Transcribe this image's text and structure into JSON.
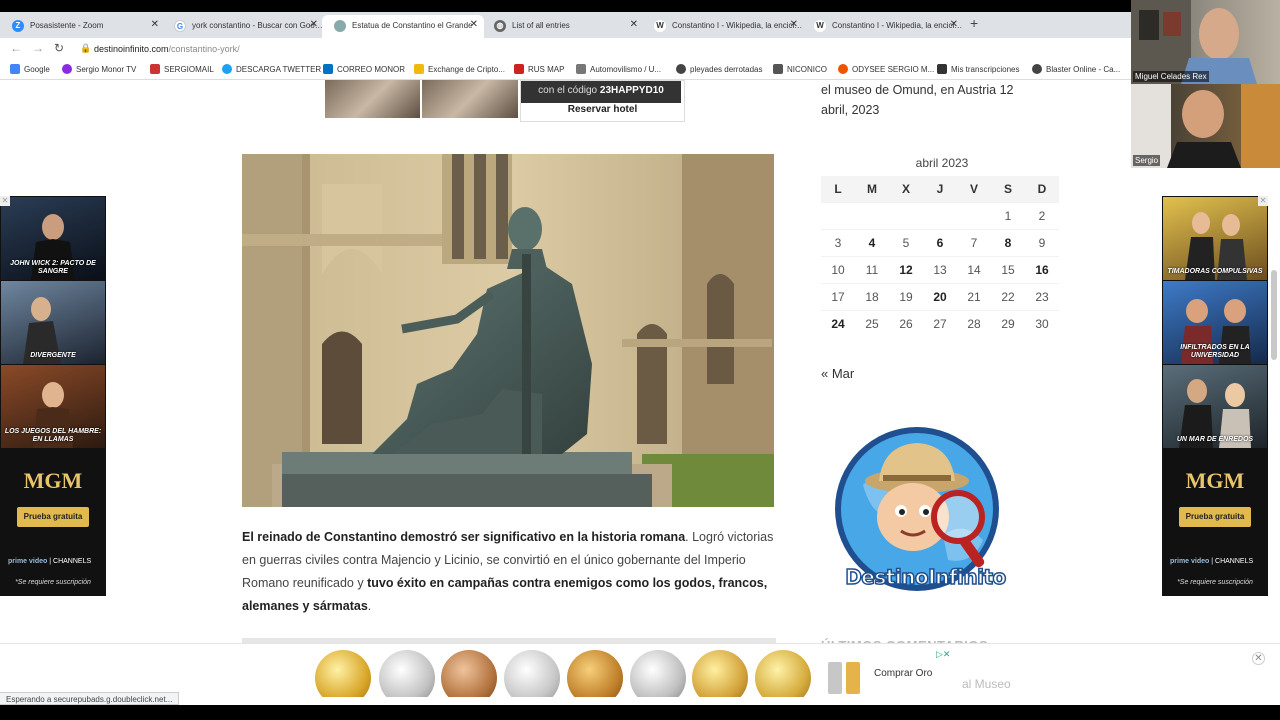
{
  "browser": {
    "tabs": [
      {
        "label": "Posasistente - Zoom",
        "icon": "zoom-icon",
        "color": "#2d8cff",
        "active": false
      },
      {
        "label": "york constantino - Buscar con Google",
        "icon": "google-icon",
        "color": "#4285f4",
        "active": false
      },
      {
        "label": "Estatua de Constantino el Grande",
        "icon": "site-icon",
        "color": "#8aa",
        "active": true
      },
      {
        "label": "List of all entries",
        "icon": "globe-icon",
        "color": "#666",
        "active": false
      },
      {
        "label": "Constantino I - Wikipedia, la enciclopedia",
        "icon": "wikipedia-icon",
        "color": "#333",
        "active": false
      },
      {
        "label": "Constantino I - Wikipedia, la enciclopedia",
        "icon": "wikipedia-icon",
        "color": "#333",
        "active": false
      }
    ],
    "new_tab": "+",
    "url_host": "destinoinfinito.com",
    "url_path": "/constantino-york/",
    "bookmarks": [
      {
        "label": "Google",
        "color": "#4285f4"
      },
      {
        "label": "Sergio Monor TV",
        "color": "#8a2be2"
      },
      {
        "label": "SERGIOMAIL",
        "color": "#c33"
      },
      {
        "label": "DESCARGA TWETTER",
        "color": "#1da1f2"
      },
      {
        "label": "CORREO MONOR",
        "color": "#0072c6"
      },
      {
        "label": "Exchange de Cripto...",
        "color": "#f0b90b"
      },
      {
        "label": "RUS MAP",
        "color": "#c22"
      },
      {
        "label": "Automovilismo / U...",
        "color": "#777"
      },
      {
        "label": "pleyades derrotadas",
        "color": "#444"
      },
      {
        "label": "NICONICO",
        "color": "#555"
      },
      {
        "label": "ODYSEE SERGIO M...",
        "color": "#e50"
      },
      {
        "label": "Mis transcripciones",
        "color": "#333"
      },
      {
        "label": "Blaster Online - Ca...",
        "color": "#444"
      }
    ]
  },
  "hotel_ad": {
    "code_prefix": "con el código",
    "code": "23HAPPYD10",
    "button": "Reservar hotel"
  },
  "article": {
    "p_bold1": "El reinado de Constantino demostró ser significativo en la historia romana",
    "p_text1": ". Logró victorias en guerras civiles contra Majencio y Licinio, se convirtió en el único gobernante del Imperio Romano reunificado y ",
    "p_bold2": "tuvo éxito en campañas contra enemigos como los godos, francos, alemanes y sármatas",
    "p_text2": "."
  },
  "sidebar": {
    "partial_text_1": "el museo de Omund, en Austria 12",
    "partial_text_2": "abril, 2023",
    "calendar": {
      "caption": "abril 2023",
      "weekdays": [
        "L",
        "M",
        "X",
        "J",
        "V",
        "S",
        "D"
      ],
      "weeks": [
        [
          "",
          "",
          "",
          "",
          "",
          "1",
          "2"
        ],
        [
          "3",
          "4",
          "5",
          "6",
          "7",
          "8",
          "9"
        ],
        [
          "10",
          "11",
          "12",
          "13",
          "14",
          "15",
          "16"
        ],
        [
          "17",
          "18",
          "19",
          "20",
          "21",
          "22",
          "23"
        ],
        [
          "24",
          "25",
          "26",
          "27",
          "28",
          "29",
          "30"
        ]
      ],
      "bold_days": [
        "4",
        "6",
        "8",
        "12",
        "16",
        "20",
        "24"
      ],
      "prev_link": "« Mar"
    },
    "logo_text": "DestinoInfinito",
    "faded_heading": "ÚLTIMOS COMENTARIOS"
  },
  "left_ad": {
    "posters": [
      "JOHN WICK 2: PACTO DE SANGRE",
      "DIVERGENTE",
      "LOS JUEGOS DEL HAMBRE: EN LLAMAS"
    ],
    "brand": "MGM",
    "button": "Prueba gratuita",
    "prime": "prime video",
    "channels": "CHANNELS",
    "note": "*Se requiere suscripción"
  },
  "right_ad": {
    "posters": [
      "TIMADORAS COMPULSIVAS",
      "INFILTRADOS EN LA UNIVERSIDAD",
      "UN MAR DE ENREDOS"
    ],
    "brand": "MGM",
    "button": "Prueba gratuita",
    "prime": "prime video",
    "channels": "CHANNELS",
    "note": "*Se requiere suscripción"
  },
  "bottom_ad": {
    "cta": "Comprar Oro",
    "ad_choices": "▷✕",
    "faint_link": "al Museo",
    "close": "✕"
  },
  "status_text": "Esperando a securepubads.g.doubleclick.net...",
  "video": {
    "participant_1": "Miguel Celades Rex",
    "participant_2": "Sergio"
  }
}
